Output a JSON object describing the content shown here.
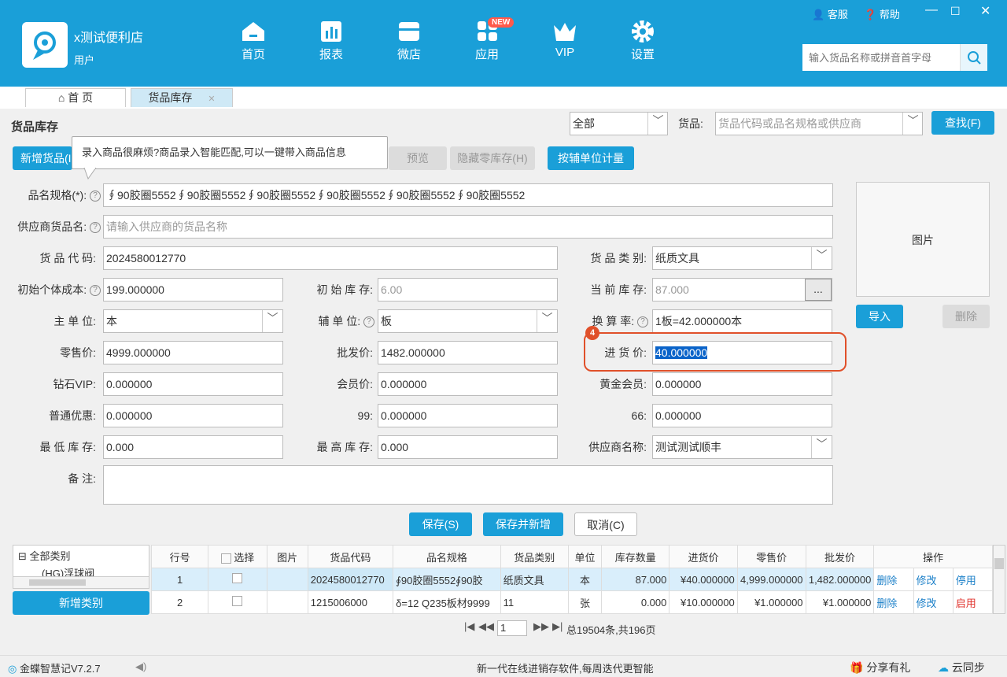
{
  "app": {
    "shop_name": "x测试便利店",
    "user": "用户",
    "service": "客服",
    "help": "帮助",
    "new_badge": "NEW"
  },
  "nav": [
    "首页",
    "报表",
    "微店",
    "应用",
    "VIP",
    "设置"
  ],
  "search": {
    "placeholder": "输入货品名称或拼音首字母"
  },
  "tabs": [
    "首 页",
    "货品库存"
  ],
  "page": {
    "title": "货品库存",
    "filter_select": "全部",
    "goods_label": "货品:",
    "goods_placeholder": "货品代码或品名规格或供应商",
    "find_btn": "查找(F)"
  },
  "toolbar": {
    "add_goods": "新增货品(I",
    "preview": "预览",
    "hide_zero": "隐藏零库存(H)",
    "aux_unit": "按辅单位计量"
  },
  "tooltip": "录入商品很麻烦?商品录入智能匹配,可以一键带入商品信息",
  "form": {
    "spec_label": "品名规格(*):",
    "spec_value": "∮90胶圈5552∮90胶圈5552∮90胶圈5552∮90胶圈5552∮90胶圈5552∮90胶圈5552",
    "supplier_name_label": "供应商货品名:",
    "supplier_name_placeholder": "请输入供应商的货品名称",
    "code_label": "货 品 代 码:",
    "code_value": "2024580012770",
    "category_label": "货 品 类 别:",
    "category_value": "纸质文具",
    "init_cost_label": "初始个体成本:",
    "init_cost_value": "199.000000",
    "init_stock_label": "初 始 库 存:",
    "init_stock_value": "6.00",
    "cur_stock_label": "当 前 库 存:",
    "cur_stock_value": "87.000",
    "more_btn": "...",
    "main_unit_label": "主 单 位:",
    "main_unit_value": "本",
    "aux_unit_label": "辅 单 位:",
    "aux_unit_value": "板",
    "ratio_label": "换 算 率:",
    "ratio_value": "1板=42.000000本",
    "retail_label": "零售价:",
    "retail_value": "4999.000000",
    "wholesale_label": "批发价:",
    "wholesale_value": "1482.000000",
    "purchase_label": "进 货 价:",
    "purchase_value": "40.000000",
    "step_num": "4",
    "diamond_label": "钻石VIP:",
    "diamond_value": "0.000000",
    "member_label": "会员价:",
    "member_value": "0.000000",
    "gold_label": "黄金会员:",
    "gold_value": "0.000000",
    "normal_label": "普通优惠:",
    "normal_value": "0.000000",
    "p99_label": "99:",
    "p99_value": "0.000000",
    "p66_label": "66:",
    "p66_value": "0.000000",
    "min_stock_label": "最 低 库 存:",
    "min_stock_value": "0.000",
    "max_stock_label": "最 高 库 存:",
    "max_stock_value": "0.000",
    "supplier_label": "供应商名称:",
    "supplier_value": "测试测试顺丰",
    "remark_label": "备 注:",
    "image_label": "图片",
    "import_btn": "导入",
    "delete_btn": "删除",
    "save_btn": "保存(S)",
    "save_new_btn": "保存并新增",
    "cancel_btn": "取消(C)"
  },
  "tree": {
    "root": "全部类别",
    "child": "(HG)浮球阀",
    "add_category": "新增类别"
  },
  "grid": {
    "headers": [
      "行号",
      "选择",
      "图片",
      "货品代码",
      "品名规格",
      "货品类别",
      "单位",
      "库存数量",
      "进货价",
      "零售价",
      "批发价",
      "操作"
    ],
    "rows": [
      {
        "no": "1",
        "code": "2024580012770",
        "spec": "∮90胶圈5552∮90胶",
        "category": "纸质文具",
        "unit": "本",
        "qty": "87.000",
        "purchase": "¥40.000000",
        "retail": "4,999.000000",
        "wholesale": "1,482.000000",
        "op1": "删除",
        "op2": "修改",
        "op3": "停用"
      },
      {
        "no": "2",
        "code": "1215006000",
        "spec": "δ=12 Q235板材9999",
        "category": "11",
        "unit": "张",
        "qty": "0.000",
        "purchase": "¥10.000000",
        "retail": "¥1.000000",
        "wholesale": "¥1.000000",
        "op1": "删除",
        "op2": "修改",
        "op3": "启用"
      }
    ]
  },
  "pager": {
    "page": "1",
    "summary": "总19504条,共196页"
  },
  "status": {
    "version": "金蝶智慧记V7.2.7",
    "slogan": "新一代在线进销存软件,每周迭代更智能",
    "share": "分享有礼",
    "sync": "云同步"
  }
}
